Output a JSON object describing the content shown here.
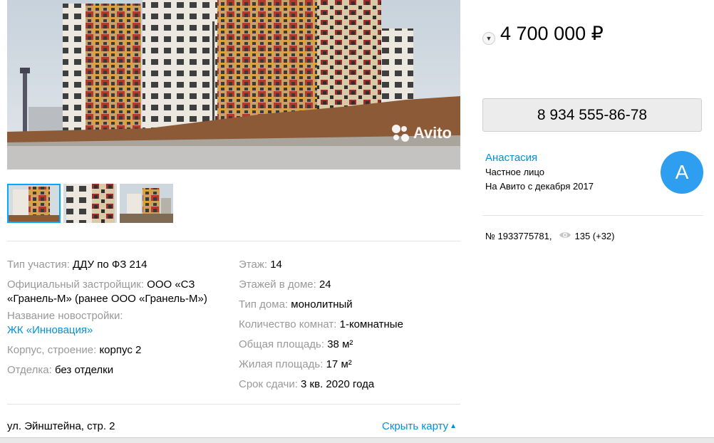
{
  "gallery": {
    "brand": "Avito",
    "thumbnail_count": 3
  },
  "params": {
    "left": [
      {
        "key": "Тип участия: ",
        "value": "ДДУ по ФЗ 214"
      },
      {
        "key": "Официальный застройщик: ",
        "value": "ООО «СЗ «Гранель-М» (ранее ООО «Гранель-М»)"
      },
      {
        "key": "Название новостройки: ",
        "value": "ЖК «Инновация»"
      },
      {
        "key": "Корпус, строение: ",
        "value": "корпус 2"
      },
      {
        "key": "Отделка: ",
        "value": "без отделки"
      }
    ],
    "right": [
      {
        "key": "Этаж: ",
        "value": "14"
      },
      {
        "key": "Этажей в доме: ",
        "value": "24"
      },
      {
        "key": "Тип дома: ",
        "value": "монолитный"
      },
      {
        "key": "Количество комнат: ",
        "value": "1-комнатные"
      },
      {
        "key": "Общая площадь: ",
        "value": "38 м²"
      },
      {
        "key": "Жилая площадь: ",
        "value": "17 м²"
      },
      {
        "key": "Срок сдачи: ",
        "value": "3 кв. 2020 года"
      }
    ]
  },
  "address": "ул. Эйнштейна, стр. 2",
  "map_toggle_label": "Скрыть карту",
  "price": "4 700 000 ₽",
  "phone": "8 934 555-86-78",
  "seller": {
    "name": "Анастасия",
    "type": "Частное лицо",
    "since": "На Авито с декабря 2017",
    "avatar_letter": "А"
  },
  "meta": {
    "number": "№ 1933775781,",
    "views": "135 (+32)"
  },
  "colors": {
    "link": "#0091d9",
    "avatar": "#2d9ef0",
    "thumb_active_border": "#00aaff"
  }
}
